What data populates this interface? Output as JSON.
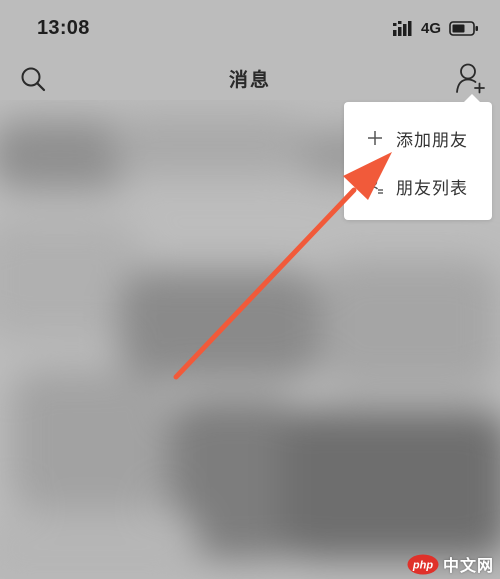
{
  "status_bar": {
    "time": "13:08",
    "network": "4G",
    "icons": [
      "signal-icon",
      "battery-icon"
    ]
  },
  "nav_bar": {
    "title": "消息",
    "left_icon": "search-icon",
    "right_icon": "add-user-icon"
  },
  "dropdown_menu": {
    "items": [
      {
        "label": "添加朋友",
        "icon": "plus-icon"
      },
      {
        "label": "朋友列表",
        "icon": "friend-list-icon"
      }
    ]
  },
  "annotation": {
    "color": "#f15a3a",
    "icon": "arrow-icon"
  },
  "watermark": {
    "logo_text": "php",
    "text": "中文网",
    "logo_color": "#e0312a"
  }
}
